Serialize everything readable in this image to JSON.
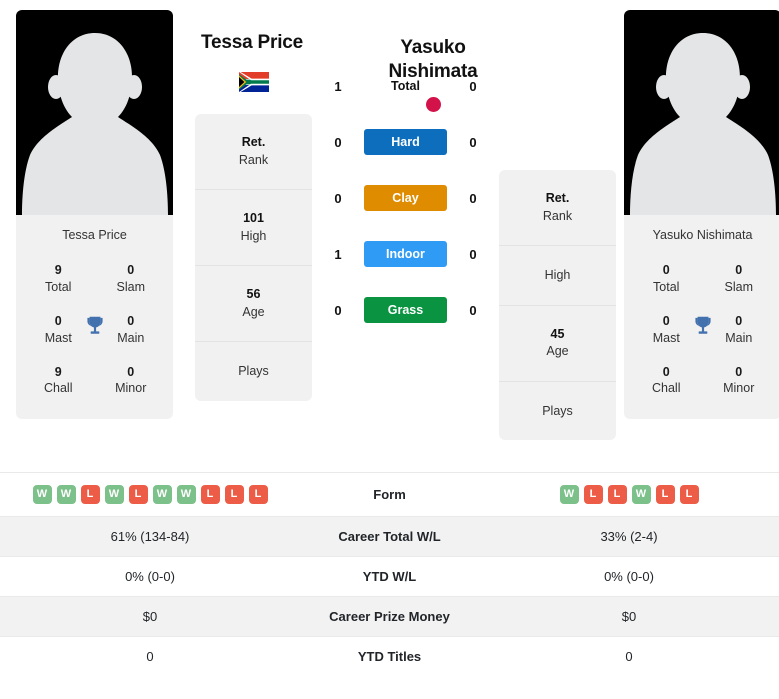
{
  "players": {
    "left": {
      "name": "Tessa Price",
      "photo_name": "Tessa Price",
      "country": "South Africa",
      "flag_icon": "flag-south-africa",
      "trophies": [
        {
          "value": "9",
          "label": "Total"
        },
        {
          "value": "0",
          "label": "Slam"
        },
        {
          "value": "0",
          "label": "Mast"
        },
        {
          "value": "0",
          "label": "Main"
        },
        {
          "value": "9",
          "label": "Chall"
        },
        {
          "value": "0",
          "label": "Minor"
        }
      ],
      "info": [
        {
          "value": "Ret.",
          "label": "Rank"
        },
        {
          "value": "101",
          "label": "High"
        },
        {
          "value": "56",
          "label": "Age"
        },
        {
          "value": "",
          "label": "Plays"
        }
      ]
    },
    "right": {
      "name": "Yasuko Nishimata",
      "photo_name": "Yasuko Nishimata",
      "country": "Japan",
      "flag_icon": "flag-japan",
      "trophies": [
        {
          "value": "0",
          "label": "Total"
        },
        {
          "value": "0",
          "label": "Slam"
        },
        {
          "value": "0",
          "label": "Mast"
        },
        {
          "value": "0",
          "label": "Main"
        },
        {
          "value": "0",
          "label": "Chall"
        },
        {
          "value": "0",
          "label": "Minor"
        }
      ],
      "info": [
        {
          "value": "Ret.",
          "label": "Rank"
        },
        {
          "value": "",
          "label": "High"
        },
        {
          "value": "45",
          "label": "Age"
        },
        {
          "value": "",
          "label": "Plays"
        }
      ]
    }
  },
  "surfaces": [
    {
      "label": "Total",
      "left": "1",
      "right": "0",
      "color": "",
      "plain": true
    },
    {
      "label": "Hard",
      "left": "0",
      "right": "0",
      "color": "#0d6ebd",
      "plain": false
    },
    {
      "label": "Clay",
      "left": "0",
      "right": "0",
      "color": "#e08c00",
      "plain": false
    },
    {
      "label": "Indoor",
      "left": "1",
      "right": "0",
      "color": "#2f9bf5",
      "plain": false
    },
    {
      "label": "Grass",
      "left": "0",
      "right": "0",
      "color": "#0a9442",
      "plain": false
    }
  ],
  "table": {
    "rows": [
      {
        "label": "Form",
        "type": "form",
        "left_form": [
          "W",
          "W",
          "L",
          "W",
          "L",
          "W",
          "W",
          "L",
          "L",
          "L"
        ],
        "right_form": [
          "W",
          "L",
          "L",
          "W",
          "L",
          "L"
        ],
        "shaded": false
      },
      {
        "label": "Career Total W/L",
        "type": "text",
        "left": "61% (134-84)",
        "right": "33% (2-4)",
        "shaded": true
      },
      {
        "label": "YTD W/L",
        "type": "text",
        "left": "0% (0-0)",
        "right": "0% (0-0)",
        "shaded": false
      },
      {
        "label": "Career Prize Money",
        "type": "text",
        "left": "$0",
        "right": "$0",
        "shaded": true
      },
      {
        "label": "YTD Titles",
        "type": "text",
        "left": "0",
        "right": "0",
        "shaded": false
      }
    ]
  },
  "colors": {
    "hard": "#0d6ebd",
    "clay": "#e08c00",
    "indoor": "#2f9bf5",
    "grass": "#0a9442",
    "win": "#7cc08a",
    "loss": "#ec5c46",
    "trophy": "#4271ad",
    "flag_jp_red": "#d4124a"
  }
}
